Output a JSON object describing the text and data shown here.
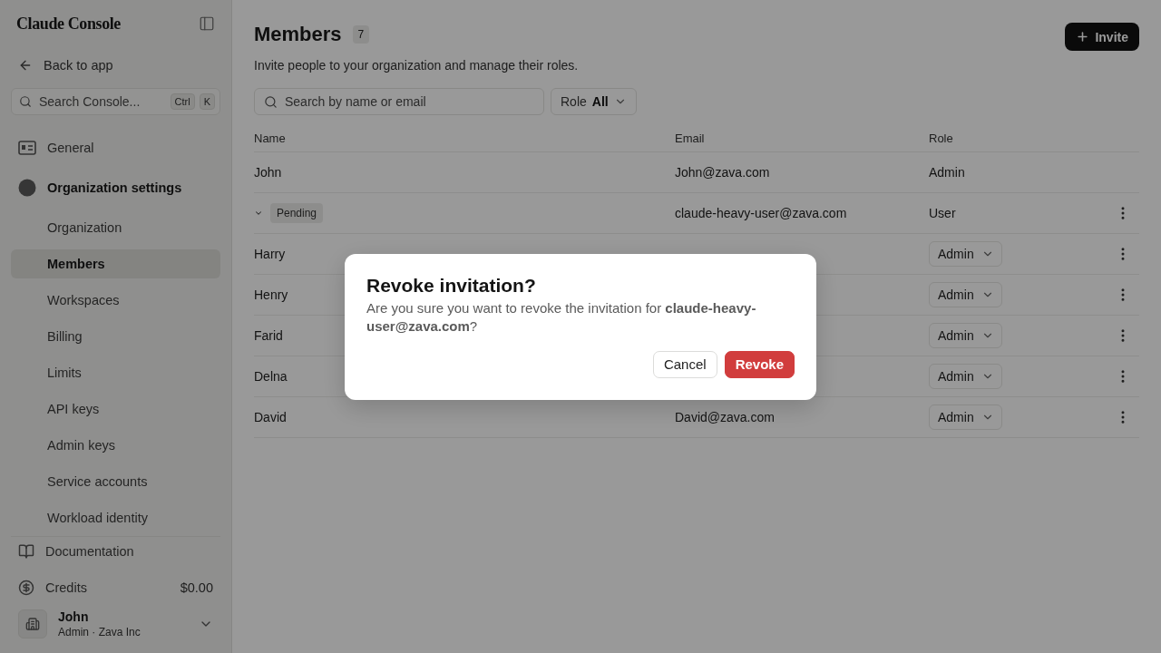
{
  "sidebar": {
    "logo": "Claude Console",
    "back_link": "Back to app",
    "search": {
      "placeholder": "Search Console...",
      "shortcut": [
        "Ctrl",
        "K"
      ]
    },
    "nav": [
      {
        "label": "General",
        "kind": "link",
        "selected": false
      },
      {
        "label": "Organization settings",
        "kind": "section",
        "children": [
          {
            "label": "Organization",
            "selected": false
          },
          {
            "label": "Members",
            "selected": true
          },
          {
            "label": "Workspaces",
            "selected": false
          },
          {
            "label": "Billing",
            "selected": false
          },
          {
            "label": "Limits",
            "selected": false
          },
          {
            "label": "API keys",
            "selected": false
          },
          {
            "label": "Admin keys",
            "selected": false
          },
          {
            "label": "Service accounts",
            "selected": false
          },
          {
            "label": "Workload identity",
            "selected": false
          }
        ]
      }
    ],
    "footer": [
      {
        "label": "Documentation",
        "kind": "docs"
      },
      {
        "label": "Credits",
        "kind": "credits",
        "value": "$0.00"
      }
    ],
    "user": {
      "name": "John",
      "subtitle": "Admin · Zava Inc"
    }
  },
  "page": {
    "title": "Members",
    "count": "7",
    "subtitle": "Invite people to your organization and manage their roles.",
    "invite_button": "Invite",
    "search": {
      "placeholder": "Search by name or email"
    },
    "role_filter": {
      "label": "Role",
      "value": "All"
    }
  },
  "table": {
    "columns": [
      "Name",
      "Email",
      "Role"
    ],
    "rows": [
      {
        "kind": "owner",
        "name": "John",
        "email": "John@zava.com",
        "role": "Admin"
      },
      {
        "kind": "pending",
        "badge": "Pending",
        "email": "claude-heavy-user@zava.com",
        "role": "User"
      },
      {
        "kind": "member",
        "name": "Harry",
        "role": "Admin"
      },
      {
        "kind": "member",
        "name": "Henry",
        "role": "Admin"
      },
      {
        "kind": "member",
        "name": "Farid",
        "role": "Admin"
      },
      {
        "kind": "member",
        "name": "Delna",
        "role": "Admin"
      },
      {
        "kind": "member",
        "name": "David",
        "email": "David@zava.com",
        "role": "Admin"
      }
    ]
  },
  "dialog": {
    "title": "Revoke invitation?",
    "message": "Are you sure you want to revoke the invitation for **claude-heavy-user@zava.com**?",
    "buttons": [
      {
        "label": "Cancel",
        "kind": "secondary"
      },
      {
        "label": "Revoke",
        "kind": "danger"
      }
    ]
  }
}
